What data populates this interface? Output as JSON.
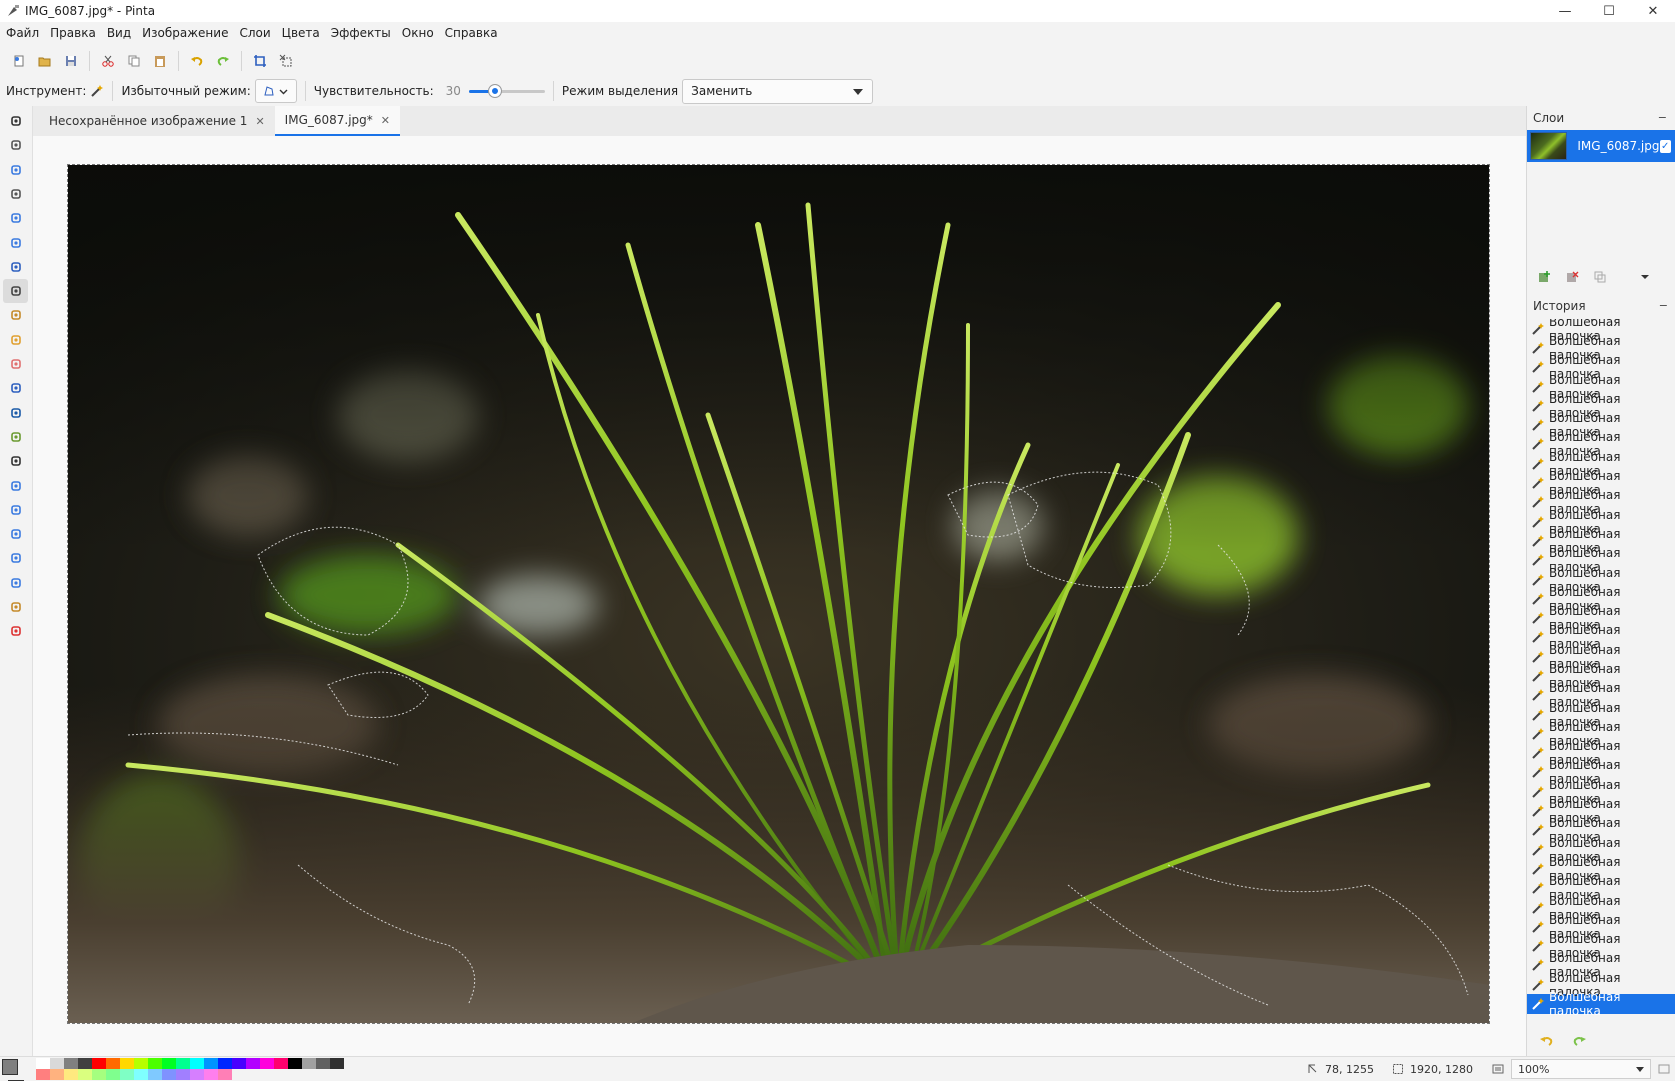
{
  "window": {
    "title": "IMG_6087.jpg* - Pinta",
    "controls": [
      "—",
      "☐",
      "✕"
    ]
  },
  "menu": [
    "Файл",
    "Правка",
    "Вид",
    "Изображение",
    "Слои",
    "Цвета",
    "Эффекты",
    "Окно",
    "Справка"
  ],
  "toolbar": {
    "buttons": [
      "new-icon",
      "open-icon",
      "save-icon",
      "cut-icon",
      "copy-icon",
      "paste-icon",
      "undo-icon",
      "redo-icon",
      "crop-icon",
      "deselect-icon"
    ]
  },
  "options": {
    "tool_label": "Инструмент:",
    "flood_label": "Избыточный режим:",
    "sensitivity_label": "Чувствительность:",
    "sensitivity_value": "30",
    "sensitivity_fraction": 0.3,
    "selection_mode_label": "Режим выделения",
    "selection_mode_value": "Заменить"
  },
  "tools": [
    "move-selected-icon",
    "move-selection-icon",
    "zoom-icon",
    "pan-icon",
    "rect-select-icon",
    "ellipse-select-icon",
    "lasso-icon",
    "magic-wand-icon",
    "paintbrush-icon",
    "pencil-icon",
    "eraser-icon",
    "paint-bucket-icon",
    "gradient-icon",
    "color-picker-icon",
    "text-icon",
    "line-icon",
    "rectangle-icon",
    "rounded-rect-icon",
    "ellipse-icon",
    "freeform-icon",
    "clone-stamp-icon",
    "recolor-icon"
  ],
  "active_tool": "magic-wand-icon",
  "tabs": [
    {
      "label": "Несохранённое изображение 1",
      "close": "✕",
      "active": false
    },
    {
      "label": "IMG_6087.jpg*",
      "close": "✕",
      "active": true
    }
  ],
  "layers": {
    "title": "Слои",
    "minimize": "−",
    "items": [
      {
        "name": "IMG_6087.jpg",
        "visible": true
      }
    ]
  },
  "history": {
    "title": "История",
    "minimize": "−",
    "item_label": "Волшебная палочка",
    "count": 36
  },
  "status": {
    "cursor_position": "78, 1255",
    "selection_size": "1920, 1280",
    "zoom": "100%"
  },
  "palette": {
    "primary": "#808080",
    "secondary": "#ffffff",
    "colors": [
      "#ffffff",
      "#d9d9d9",
      "#808080",
      "#404040",
      "#ff0000",
      "#ff6a00",
      "#ffd800",
      "#b6ff00",
      "#4cff00",
      "#00ff21",
      "#00ff90",
      "#00ffff",
      "#0094ff",
      "#0026ff",
      "#4800ff",
      "#b200ff",
      "#ff00dc",
      "#ff006e",
      "#000000",
      "#a0a0a0",
      "#606060",
      "#303030",
      "#ff7f7f",
      "#ffb27f",
      "#ffe97f",
      "#daff7f",
      "#a5ff7f",
      "#7fff8e",
      "#7fffc5",
      "#7fffff",
      "#7fc9ff",
      "#7f92ff",
      "#a17fff",
      "#d67fff",
      "#ff7fed",
      "#ff7fb6"
    ]
  },
  "accent": "#1a73e8"
}
